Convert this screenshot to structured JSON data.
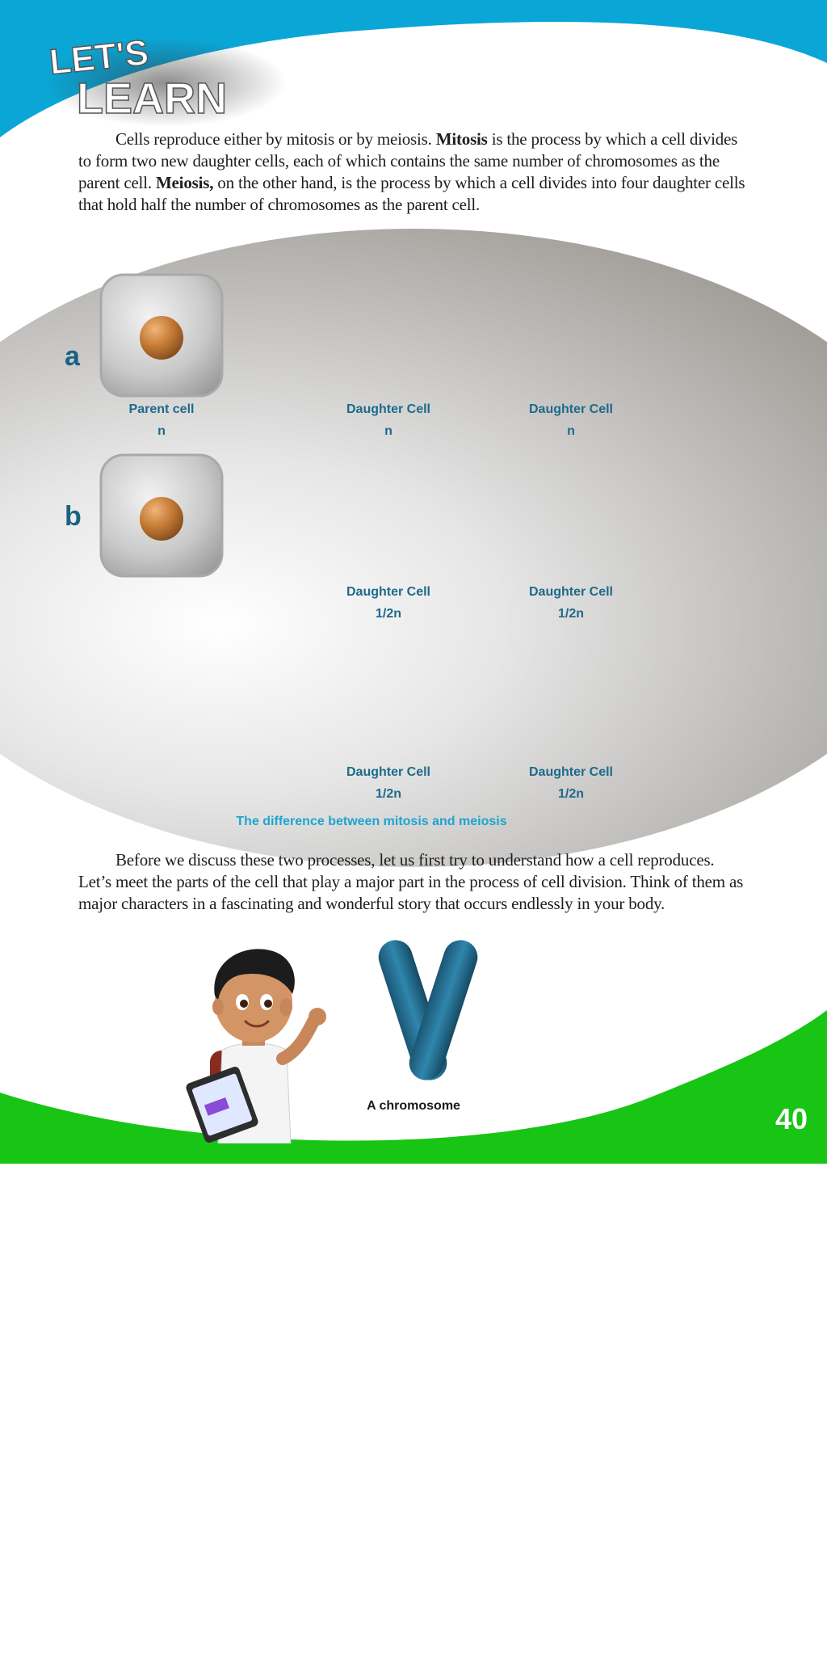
{
  "header": {
    "badge_line1": "LET'S",
    "badge_line2": "LEARN"
  },
  "intro": {
    "parts": [
      "Cells reproduce either by mitosis or by meiosis. ",
      "Mitosis",
      " is the process by which a cell divides to form two new daughter cells, each of which contains the same number of chromosomes as the parent cell. ",
      "Meiosis,",
      " on the other hand, is the process by which a cell divides into four daughter cells that hold half the number of chromosomes as the parent cell."
    ]
  },
  "diagram": {
    "row_a": {
      "letter": "a",
      "parent": {
        "name": "Parent cell",
        "value": "n"
      },
      "daughters": [
        {
          "name": "Daughter Cell",
          "value": "n"
        },
        {
          "name": "Daughter Cell",
          "value": "n"
        }
      ]
    },
    "row_b": {
      "letter": "b",
      "daughters": [
        {
          "name": "Daughter Cell",
          "value": "1/2n"
        },
        {
          "name": "Daughter Cell",
          "value": "1/2n"
        },
        {
          "name": "Daughter Cell",
          "value": "1/2n"
        },
        {
          "name": "Daughter Cell",
          "value": "1/2n"
        }
      ]
    },
    "caption": "The difference between mitosis and meiosis"
  },
  "story": {
    "text": "Before we discuss these two processes, let us first try to understand how a cell reproduces. Let’s meet the parts of the cell that play a major part in the process of cell division. Think of them as major characters in a fascinating and wonderful story that occurs endlessly in your body."
  },
  "chromosome": {
    "caption": "A chromosome"
  },
  "footer": {
    "page_number": "40"
  },
  "colors": {
    "header_blue": "#0aa6d6",
    "footer_green": "#18c414",
    "label_blue": "#1d6a8a",
    "caption_blue": "#1ba5d0"
  }
}
